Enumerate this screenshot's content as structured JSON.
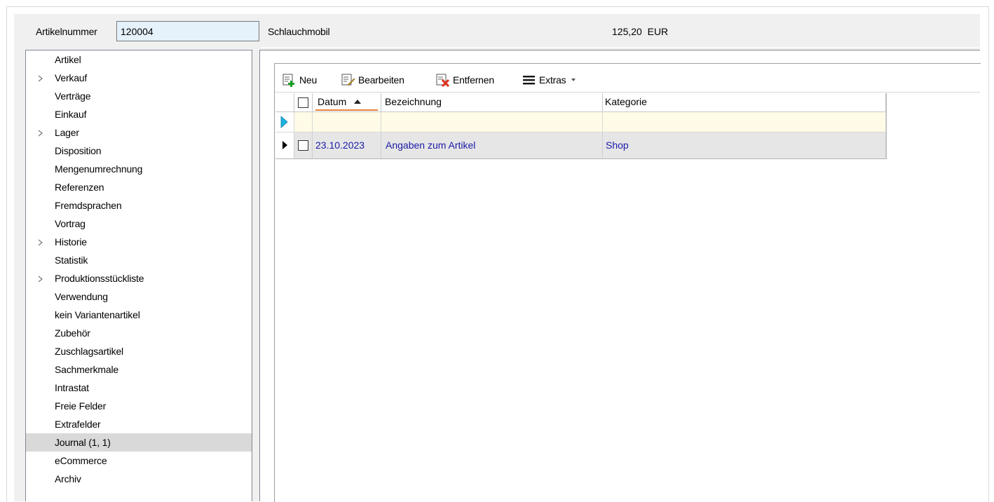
{
  "header": {
    "article_number_label": "Artikelnummer",
    "article_number_value": "120004",
    "article_name": "Schlauchmobil",
    "price": "125,20",
    "currency": "EUR"
  },
  "nav": {
    "items": [
      {
        "label": "Artikel",
        "expandable": false,
        "selected": false
      },
      {
        "label": "Verkauf",
        "expandable": true,
        "selected": false
      },
      {
        "label": "Verträge",
        "expandable": false,
        "selected": false
      },
      {
        "label": "Einkauf",
        "expandable": false,
        "selected": false
      },
      {
        "label": "Lager",
        "expandable": true,
        "selected": false
      },
      {
        "label": "Disposition",
        "expandable": false,
        "selected": false
      },
      {
        "label": "Mengenumrechnung",
        "expandable": false,
        "selected": false
      },
      {
        "label": "Referenzen",
        "expandable": false,
        "selected": false
      },
      {
        "label": "Fremdsprachen",
        "expandable": false,
        "selected": false
      },
      {
        "label": "Vortrag",
        "expandable": false,
        "selected": false
      },
      {
        "label": "Historie",
        "expandable": true,
        "selected": false
      },
      {
        "label": "Statistik",
        "expandable": false,
        "selected": false
      },
      {
        "label": "Produktionsstückliste",
        "expandable": true,
        "selected": false
      },
      {
        "label": "Verwendung",
        "expandable": false,
        "selected": false
      },
      {
        "label": "kein Variantenartikel",
        "expandable": false,
        "selected": false
      },
      {
        "label": "Zubehör",
        "expandable": false,
        "selected": false
      },
      {
        "label": "Zuschlagsartikel",
        "expandable": false,
        "selected": false
      },
      {
        "label": "Sachmerkmale",
        "expandable": false,
        "selected": false
      },
      {
        "label": "Intrastat",
        "expandable": false,
        "selected": false
      },
      {
        "label": "Freie Felder",
        "expandable": false,
        "selected": false
      },
      {
        "label": "Extrafelder",
        "expandable": false,
        "selected": false
      },
      {
        "label": "Journal (1, 1)",
        "expandable": false,
        "selected": true
      },
      {
        "label": "eCommerce",
        "expandable": false,
        "selected": false
      },
      {
        "label": "Archiv",
        "expandable": false,
        "selected": false
      }
    ]
  },
  "toolbar": {
    "new_label": "Neu",
    "edit_label": "Bearbeiten",
    "delete_label": "Entfernen",
    "extras_label": "Extras"
  },
  "grid": {
    "columns": [
      "Datum",
      "Bezeichnung",
      "Kategorie"
    ],
    "sort_column": "Datum",
    "sort_direction": "ascending",
    "rows": [
      {
        "datum": "23.10.2023",
        "bezeichnung": "Angaben zum Artikel",
        "kategorie": "Shop"
      }
    ]
  },
  "colors": {
    "selection_gray": "#d9d9d9",
    "input_bg": "#e5f1fb",
    "new_row_bg": "#fffbe6",
    "row_text_blue": "#1a1aa8",
    "sort_underline": "#e8833a",
    "new_row_indicator": "#1ab4e0"
  },
  "icons": {
    "new": "add-document-icon",
    "edit": "edit-document-icon",
    "delete": "delete-document-icon",
    "extras": "hamburger-menu-icon"
  }
}
